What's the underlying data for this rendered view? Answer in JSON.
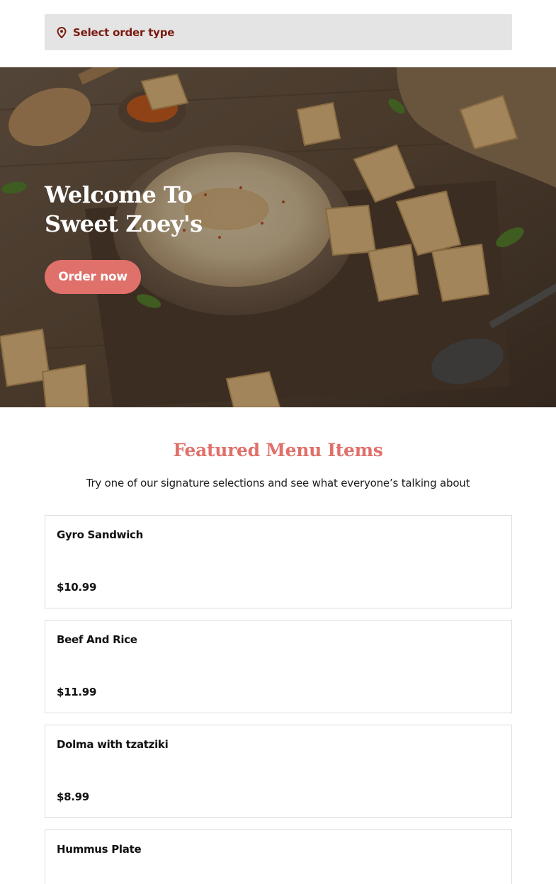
{
  "order_bar": {
    "label": "Select order type",
    "icon": "map-pin-icon",
    "color": "#7a1a10"
  },
  "hero": {
    "title": "Welcome To Sweet Zoey's",
    "order_button": "Order now",
    "accent": "#e0706a"
  },
  "featured": {
    "title": "Featured Menu Items",
    "subtitle": "Try one of our signature selections and see what everyone’s talking about",
    "items": [
      {
        "name": "Gyro Sandwich",
        "price": "$10.99"
      },
      {
        "name": "Beef And Rice",
        "price": "$11.99"
      },
      {
        "name": "Dolma with tzatziki",
        "price": "$8.99"
      },
      {
        "name": "Hummus Plate",
        "price": ""
      }
    ]
  }
}
